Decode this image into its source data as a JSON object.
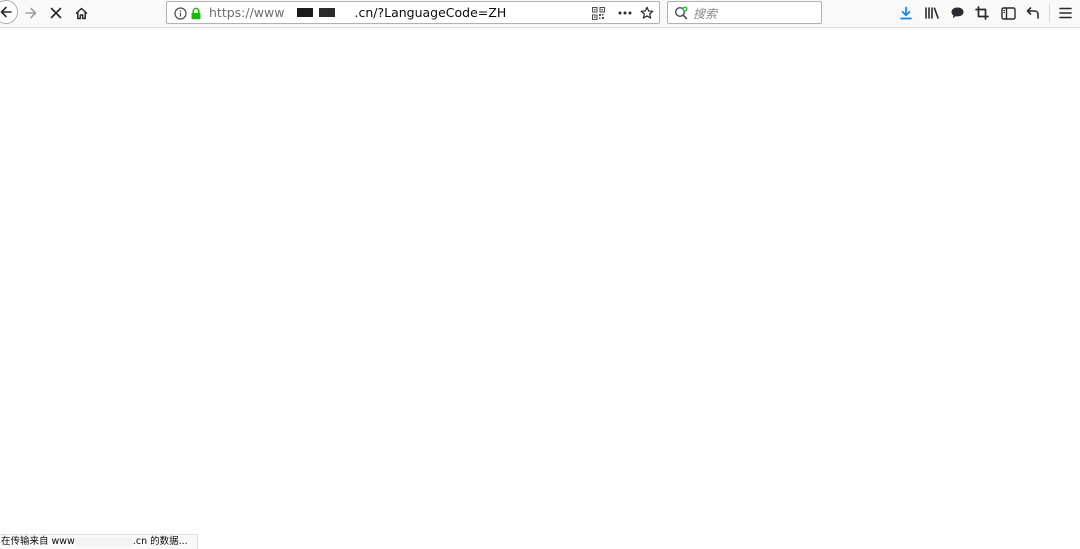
{
  "browser": {
    "url_prefix": "https://www",
    "url_suffix": ".cn/?LanguageCode=ZH",
    "search_placeholder": "搜索",
    "status_prefix": "在传输来自 www",
    "status_suffix": ".cn 的数据..."
  },
  "icons": {
    "back": "back-arrow-icon",
    "forward": "forward-arrow-icon",
    "stop": "stop-x-icon",
    "home": "home-icon",
    "info": "info-icon",
    "lock": "lock-icon",
    "qr": "qr-code-icon",
    "more": "page-actions-icon",
    "bookmark": "star-icon",
    "search_engine": "search-engine-icon",
    "download": "download-icon",
    "library": "library-icon",
    "chat": "chat-bubble-icon",
    "screenshot": "screenshot-crop-icon",
    "sidebar": "sidebar-icon",
    "undo": "undo-arrow-icon",
    "menu": "hamburger-menu-icon"
  },
  "colors": {
    "toolbar_bg": "#f9f9fa",
    "lock_green": "#12bc00",
    "download_blue": "#0a84ff",
    "search_green": "#30b93e"
  }
}
